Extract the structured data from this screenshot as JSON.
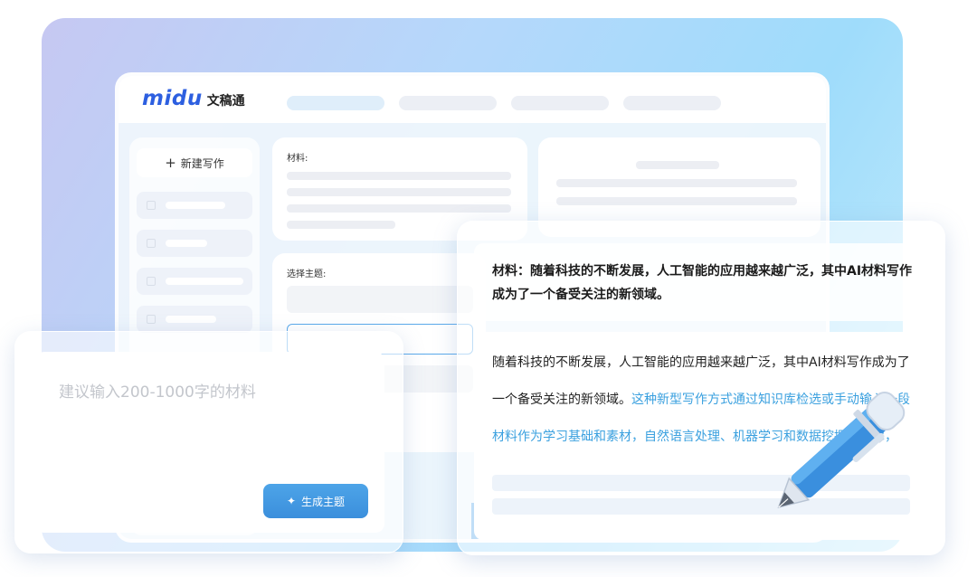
{
  "app": {
    "logo_word": "midu",
    "logo_name": "文稿通"
  },
  "sidebar": {
    "new_label": "新建写作"
  },
  "material_panel": {
    "label": "材料:"
  },
  "topic_panel": {
    "label": "选择主题:"
  },
  "input_card": {
    "placeholder": "建议输入200-1000字的材料",
    "generate_label": "生成主题"
  },
  "result_card": {
    "material_text": "材料：随着科技的不断发展，人工智能的应用越来越广泛，其中AI材料写作成为了一个备受关注的新领域。",
    "article_dark": "随着科技的不断发展，人工智能的应用越来越广泛，其中AI材料写作成为了一个备受关注的新领域。",
    "article_highlight": "这种新型写作方式通过知识库检选或手动输入一段材料作为学习基础和素材，自然语言处理、机器学习和数据挖掘等技术，"
  },
  "colors": {
    "accent": "#3b8fdc",
    "highlight": "#3aa0df",
    "logo": "#2d5fe0"
  },
  "icons": [
    "plus-icon",
    "sparkle-icon",
    "pen-icon"
  ]
}
